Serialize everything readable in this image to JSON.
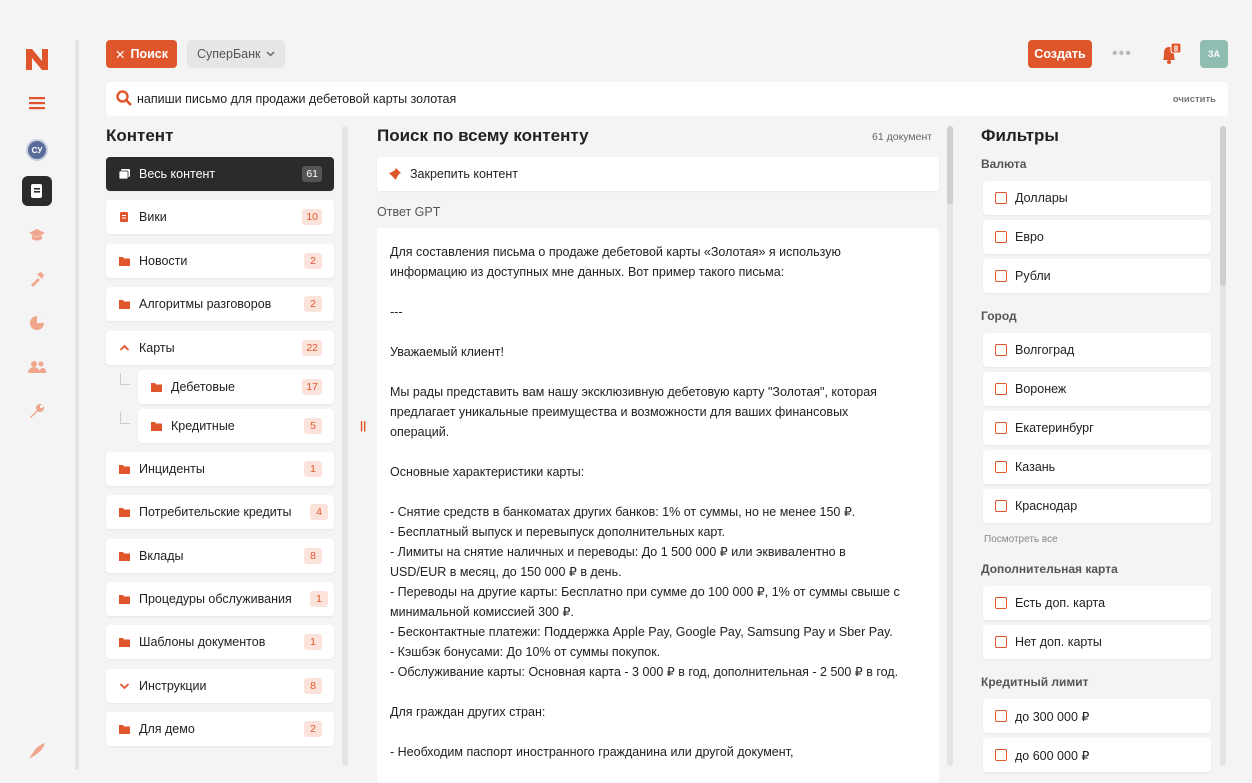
{
  "brand": {
    "logo_letter": "N",
    "accent": "#e0562c",
    "dark": "#2b2b2d"
  },
  "rail": {
    "user_initials": "СУ",
    "items": [
      "menu-icon",
      "user-avatar",
      "documents-icon",
      "graduation-cap-icon",
      "hammer-icon",
      "pie-chart-icon",
      "users-icon",
      "wrench-icon",
      "rocket-icon"
    ]
  },
  "topbar": {
    "search_button": "Поиск",
    "bank_selector": "СуперБанк",
    "create_button": "Создать",
    "notifications_count": "8",
    "user_initials": "ЗА"
  },
  "search": {
    "query": "напиши письмо для продажи дебетовой карты золотая",
    "clear_label": "очистить"
  },
  "content": {
    "title": "Контент",
    "items": [
      {
        "label": "Весь контент",
        "count": "61"
      },
      {
        "label": "Вики",
        "count": "10"
      },
      {
        "label": "Новости",
        "count": "2"
      },
      {
        "label": "Алгоритмы разговоров",
        "count": "2"
      },
      {
        "label": "Карты",
        "count": "22"
      },
      {
        "label": "Дебетовые",
        "count": "17"
      },
      {
        "label": "Кредитные",
        "count": "5"
      },
      {
        "label": "Инциденты",
        "count": "1"
      },
      {
        "label": "Потребительские кредиты",
        "count": "4"
      },
      {
        "label": "Вклады",
        "count": "8"
      },
      {
        "label": "Процедуры обслуживания",
        "count": "1"
      },
      {
        "label": "Шаблоны документов",
        "count": "1"
      },
      {
        "label": "Инструкции",
        "count": "8"
      },
      {
        "label": "Для демо",
        "count": "2"
      }
    ]
  },
  "main": {
    "title": "Поиск по всему контенту",
    "doc_count": "61 документ",
    "pin_label": "Закрепить контент",
    "gpt_label": "Ответ GPT",
    "answer": "Для составления письма о продаже дебетовой карты «Золотая» я использую\nинформацию из доступных мне данных. Вот пример такого письма:\n\n---\n\nУважаемый клиент!\n\nМы рады представить вам нашу эксклюзивную дебетовую карту \"Золотая\", которая\nпредлагает уникальные преимущества и возможности для ваших финансовых\nопераций.\n\nОсновные характеристики карты:\n\n- Снятие средств в банкоматах других банков: 1% от суммы, но не менее 150 ₽.\n- Бесплатный выпуск и перевыпуск дополнительных карт.\n- Лимиты на снятие наличных и переводы: До 1 500 000 ₽ или эквивалентно в\nUSD/EUR в месяц, до 150 000 ₽ в день.\n- Переводы на другие карты: Бесплатно при сумме до 100 000 ₽, 1% от суммы свыше с\nминимальной комиссией 300 ₽.\n- Бесконтактные платежи: Поддержка Apple Pay, Google Pay, Samsung Pay и Sber Pay.\n- Кэшбэк бонусами: До 10% от суммы покупок.\n- Обслуживание карты: Основная карта - 3 000 ₽ в год, дополнительная - 2 500 ₽ в год.\n\nДля граждан других стран:\n\n- Необходим паспорт иностранного гражданина или другой документ,"
  },
  "filters": {
    "title": "Фильтры",
    "currency_title": "Валюта",
    "currency": [
      "Доллары",
      "Евро",
      "Рубли"
    ],
    "city_title": "Город",
    "city": [
      "Волгоград",
      "Воронеж",
      "Екатеринбург",
      "Казань",
      "Краснодар"
    ],
    "see_all": "Посмотреть все",
    "extra_title": "Дополнительная карта",
    "extra": [
      "Есть доп. карта",
      "Нет доп. карты"
    ],
    "limit_title": "Кредитный лимит",
    "limit": [
      "до 300 000 ₽",
      "до 600 000 ₽"
    ]
  }
}
